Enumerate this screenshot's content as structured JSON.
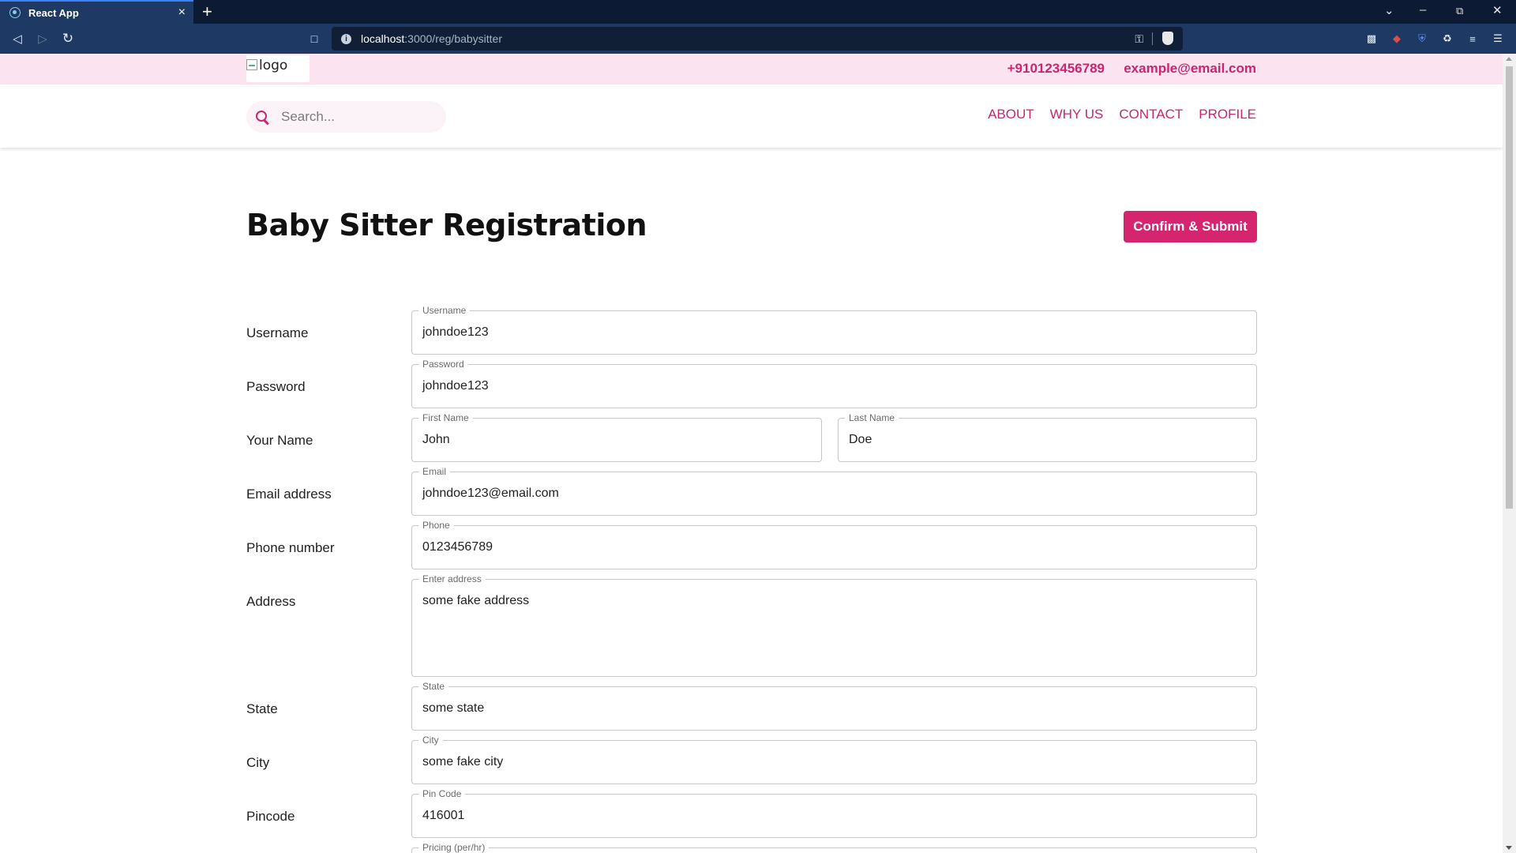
{
  "browser": {
    "tab_title": "React App",
    "tab_close": "×",
    "new_tab": "+",
    "url_host": "localhost",
    "url_path": ":3000/reg/babysitter"
  },
  "topbar": {
    "logo_alt": "logo",
    "phone": "+910123456789",
    "email": "example@email.com"
  },
  "navbar": {
    "search_placeholder": "Search...",
    "links": [
      "ABOUT",
      "WHY US",
      "CONTACT",
      "PROFILE"
    ]
  },
  "page": {
    "title": "Baby Sitter Registration",
    "submit_label": "Confirm & Submit"
  },
  "form": {
    "username": {
      "label": "Username",
      "legend": "Username",
      "value": "johndoe123"
    },
    "password": {
      "label": "Password",
      "legend": "Password",
      "value": "johndoe123"
    },
    "name": {
      "label": "Your Name",
      "first_legend": "First Name",
      "first_value": "John",
      "last_legend": "Last Name",
      "last_value": "Doe"
    },
    "email": {
      "label": "Email address",
      "legend": "Email",
      "value": "johndoe123@email.com"
    },
    "phone": {
      "label": "Phone number",
      "legend": "Phone",
      "value": "0123456789"
    },
    "address": {
      "label": "Address",
      "legend": "Enter address",
      "value": "some fake address"
    },
    "state": {
      "label": "State",
      "legend": "State",
      "value": "some state"
    },
    "city": {
      "label": "City",
      "legend": "City",
      "value": "some fake city"
    },
    "pincode": {
      "label": "Pincode",
      "legend": "Pin Code",
      "value": "416001"
    },
    "pricing": {
      "legend": "Pricing (per/hr)"
    }
  },
  "colors": {
    "accent": "#d6256f",
    "topbar_bg": "#fbe4f0",
    "chrome_bg": "#1e3a64"
  }
}
